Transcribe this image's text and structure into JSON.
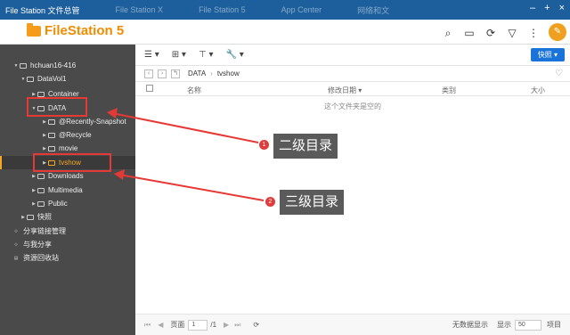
{
  "window": {
    "title": "File Station 文件总管",
    "ghost_tabs": [
      "File Station X",
      "File Station 5",
      "App Center",
      "网络和文"
    ],
    "controls": [
      "–",
      "+",
      "×"
    ]
  },
  "app": {
    "name": "FileStation 5"
  },
  "header": {
    "icons": [
      "search-icon",
      "storage-icon",
      "refresh-icon",
      "filter-icon",
      "more-icon"
    ]
  },
  "toolbar": {
    "items": [
      "☰ ▾",
      "⊞ ▾",
      "⊤ ▾",
      "🔧 ▾"
    ],
    "quick_button": "快照 ▾"
  },
  "sidebar": {
    "nodes": [
      {
        "label": "hchuan16-416"
      },
      {
        "label": "DataVol1"
      },
      {
        "label": "Container"
      },
      {
        "label": "DATA"
      },
      {
        "label": "@Recently-Snapshot"
      },
      {
        "label": "@Recycle"
      },
      {
        "label": "movie"
      },
      {
        "label": "tvshow"
      },
      {
        "label": "Downloads"
      },
      {
        "label": "Multimedia"
      },
      {
        "label": "Public"
      },
      {
        "label": "快照"
      },
      {
        "label": "分享链接管理"
      },
      {
        "label": "与我分享"
      },
      {
        "label": "资源回收站"
      }
    ]
  },
  "pathbar": {
    "path": [
      "DATA",
      "tvshow"
    ]
  },
  "table": {
    "headers": {
      "name": "名称",
      "modified": "修改日期 ▾",
      "type": "类别",
      "size": "大小"
    },
    "empty_text": "这个文件夹是空的"
  },
  "footer": {
    "page_label": "页面",
    "page_value": "1",
    "page_total": "/1",
    "status": "无数据显示",
    "show_label": "显示",
    "per_page": "50",
    "items_label": "项目"
  },
  "annotations": [
    {
      "number": "1",
      "text": "二级目录"
    },
    {
      "number": "2",
      "text": "三级目录"
    }
  ],
  "colors": {
    "accent": "#f5a623",
    "title_bar": "#1d5f9c",
    "sidebar": "#4a4a4a",
    "annotation_red": "#e53935"
  }
}
